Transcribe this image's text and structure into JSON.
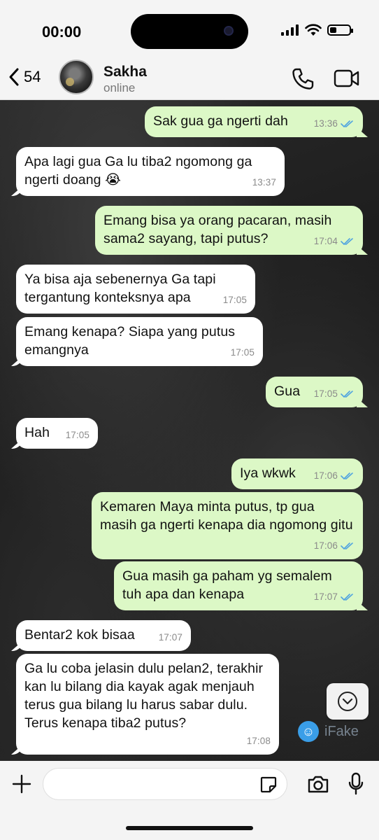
{
  "status_bar": {
    "time": "00:00",
    "battery_level": 0.35
  },
  "header": {
    "back_count": "54",
    "contact_name": "Sakha",
    "contact_status": "online"
  },
  "messages": [
    {
      "dir": "out",
      "text": "Sak gua ga ngerti dah",
      "time": "13:36",
      "read": true
    },
    {
      "dir": "in",
      "text": "Apa lagi gua Ga lu tiba2 ngomong ga ngerti doang 😭",
      "time": "13:37"
    },
    {
      "dir": "out",
      "text": "Emang bisa ya orang pacaran, masih sama2 sayang, tapi putus?",
      "time": "17:04",
      "read": true
    },
    {
      "dir": "in",
      "text": "Ya bisa aja sebenernya Ga tapi tergantung konteksnya apa",
      "time": "17:05"
    },
    {
      "dir": "in",
      "text": "Emang kenapa? Siapa yang putus emangnya",
      "time": "17:05"
    },
    {
      "dir": "out",
      "text": "Gua",
      "time": "17:05",
      "read": true
    },
    {
      "dir": "in",
      "text": "Hah",
      "time": "17:05"
    },
    {
      "dir": "out",
      "text": "Iya wkwk",
      "time": "17:06",
      "read": true
    },
    {
      "dir": "out",
      "text": "Kemaren Maya minta putus, tp gua masih ga ngerti kenapa dia ngomong gitu",
      "time": "17:06",
      "read": true
    },
    {
      "dir": "out",
      "text": "Gua masih ga paham yg semalem tuh apa dan kenapa",
      "time": "17:07",
      "read": true
    },
    {
      "dir": "in",
      "text": "Bentar2 kok bisaa",
      "time": "17:07"
    },
    {
      "dir": "in",
      "text": "Ga lu coba jelasin dulu pelan2, terakhir kan lu bilang dia kayak agak menjauh terus gua bilang lu harus sabar dulu. Terus kenapa tiba2 putus?",
      "time": "17:08"
    }
  ],
  "watermark": {
    "text": "iFake"
  },
  "colors": {
    "out_bubble": "#dcf8c6",
    "in_bubble": "#ffffff",
    "read_tick": "#4fa3e0"
  },
  "icons": [
    "back-chevron-icon",
    "phone-icon",
    "video-camera-icon",
    "chevron-down-icon",
    "plus-icon",
    "sticker-icon",
    "camera-icon",
    "microphone-icon"
  ]
}
